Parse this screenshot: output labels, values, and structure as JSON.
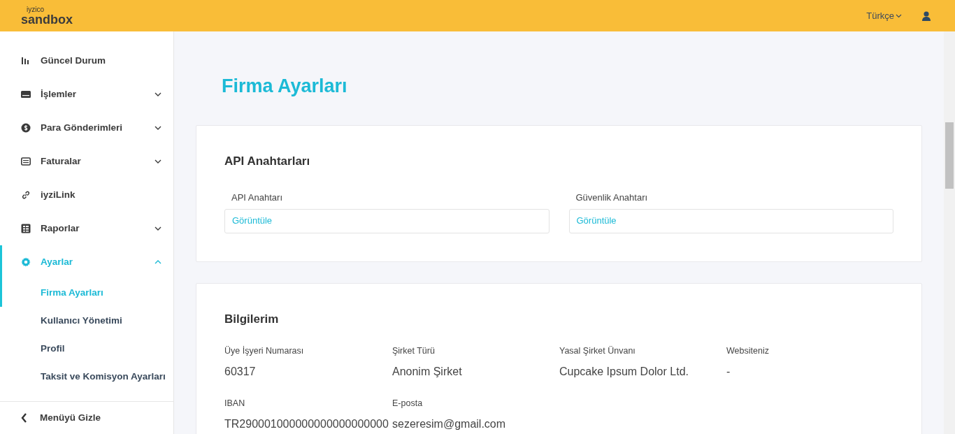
{
  "header": {
    "logo_small": "iyzico",
    "logo": "sandbox",
    "language": "Türkçe"
  },
  "sidebar": {
    "items": [
      {
        "label": "Güncel Durum",
        "selected": false
      },
      {
        "label": "İşlemler",
        "selected": false,
        "expanded": false
      },
      {
        "label": "Para Gönderimleri",
        "selected": false,
        "expanded": false
      },
      {
        "label": "Faturalar",
        "selected": false,
        "expanded": false
      },
      {
        "label": "iyziLink",
        "selected": false
      },
      {
        "label": "Raporlar",
        "selected": false,
        "expanded": false
      },
      {
        "label": "Ayarlar",
        "selected": true,
        "expanded": true,
        "children": [
          {
            "label": "Firma Ayarları",
            "selected": true
          },
          {
            "label": "Kullanıcı Yönetimi",
            "selected": false
          },
          {
            "label": "Profil",
            "selected": false
          },
          {
            "label": "Taksit ve Komisyon Ayarları",
            "selected": false
          }
        ]
      }
    ],
    "footer": "Menüyü Gizle"
  },
  "page_title": "Firma Ayarları",
  "api_card": {
    "title": "API Anahtarları",
    "fields": [
      {
        "label": "API Anahtarı",
        "link": "Görüntüle"
      },
      {
        "label": "Güvenlik Anahtarı",
        "link": "Görüntüle"
      }
    ]
  },
  "info_card": {
    "title": "Bilgilerim",
    "fields": [
      {
        "label": "Üye İşyeri Numarası",
        "value": "60317"
      },
      {
        "label": "Şirket Türü",
        "value": "Anonim Şirket"
      },
      {
        "label": "Yasal Şirket Ünvanı",
        "value": "Cupcake Ipsum Dolor Ltd."
      },
      {
        "label": "Websiteniz",
        "value": "-"
      },
      {
        "label": "IBAN",
        "value": "TR290001000000000000000000"
      },
      {
        "label": "E-posta",
        "value": "sezeresim@gmail.com"
      }
    ]
  }
}
